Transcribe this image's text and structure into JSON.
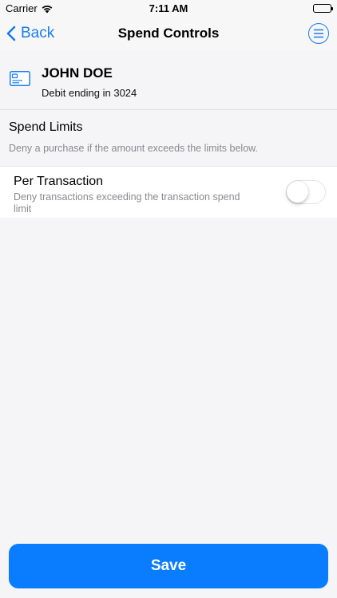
{
  "status_bar": {
    "carrier": "Carrier",
    "time": "7:11 AM",
    "wifi_icon": "wifi-icon",
    "battery_icon": "battery-icon"
  },
  "nav": {
    "back_label": "Back",
    "title": "Spend Controls",
    "menu_icon": "menu-icon"
  },
  "card": {
    "icon": "credit-card-icon",
    "name": "JOHN DOE",
    "subtitle": "Debit ending in 3024"
  },
  "spend_limits": {
    "title": "Spend Limits",
    "description": "Deny a purchase if the amount exceeds the limits below."
  },
  "per_transaction": {
    "title": "Per Transaction",
    "description": "Deny transactions exceeding the transaction spend limit",
    "enabled": false
  },
  "actions": {
    "save_label": "Save"
  },
  "colors": {
    "accent": "#1a7cf2",
    "save_button": "#0a7cfe",
    "background": "#f5f5f7",
    "secondary_text": "#8a8a8e"
  }
}
